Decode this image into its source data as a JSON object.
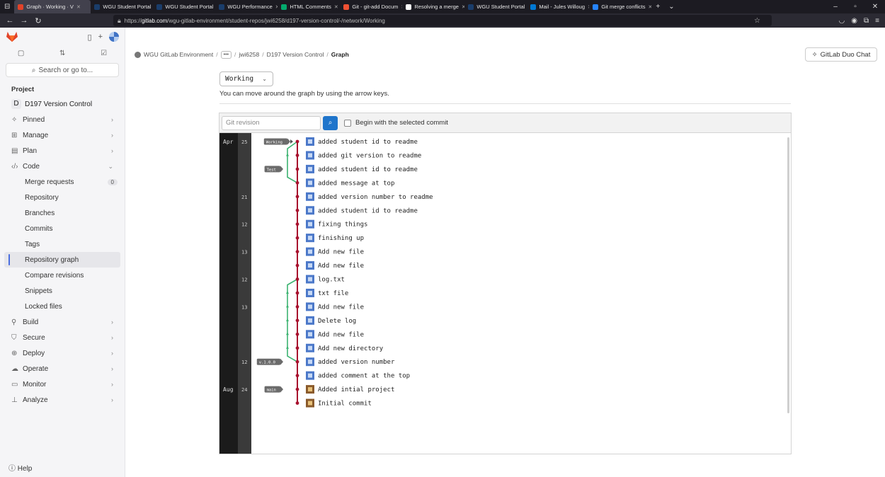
{
  "browser": {
    "tabs": [
      {
        "title": "Graph · Working · V",
        "active": true,
        "color": "#e24329"
      },
      {
        "title": "WGU Student Portal",
        "active": false,
        "color": "#1a3d6b"
      },
      {
        "title": "WGU Student Portal",
        "active": false,
        "color": "#1a3d6b"
      },
      {
        "title": "WGU Performance",
        "active": false,
        "color": "#1a3d6b"
      },
      {
        "title": "HTML Comments",
        "active": false,
        "color": "#04aa6d"
      },
      {
        "title": "Git - git-add Docum",
        "active": false,
        "color": "#f05133"
      },
      {
        "title": "Resolving a merge",
        "active": false,
        "color": "#ffffff"
      },
      {
        "title": "WGU Student Portal",
        "active": false,
        "color": "#1a3d6b"
      },
      {
        "title": "Mail - Jules Willoug",
        "active": false,
        "color": "#0078d4"
      },
      {
        "title": "Git merge conflicts",
        "active": false,
        "color": "#2684ff"
      }
    ],
    "url_prefix": "https://",
    "url_host": "gitlab.com",
    "url_path": "/wgu-gitlab-environment/student-repos/jwi6258/d197-version-control/-/network/Working"
  },
  "sidebar": {
    "search_label": "Search or go to...",
    "section_label": "Project",
    "project_letter": "D",
    "project_name": "D197 Version Control",
    "items_top": [
      {
        "icon": "pin-icon",
        "glyph": "✧",
        "label": "Pinned",
        "chevron": "›"
      },
      {
        "icon": "manage-icon",
        "glyph": "⊞",
        "label": "Manage",
        "chevron": "›"
      },
      {
        "icon": "plan-icon",
        "glyph": "▤",
        "label": "Plan",
        "chevron": "›"
      },
      {
        "icon": "code-icon",
        "glyph": "‹/›",
        "label": "Code",
        "chevron": "⌄"
      }
    ],
    "code_subitems": [
      {
        "label": "Merge requests",
        "badge": "0"
      },
      {
        "label": "Repository"
      },
      {
        "label": "Branches"
      },
      {
        "label": "Commits"
      },
      {
        "label": "Tags"
      },
      {
        "label": "Repository graph",
        "active": true
      },
      {
        "label": "Compare revisions"
      },
      {
        "label": "Snippets"
      },
      {
        "label": "Locked files"
      }
    ],
    "items_bottom": [
      {
        "icon": "rocket-icon",
        "glyph": "⚲",
        "label": "Build",
        "chevron": "›"
      },
      {
        "icon": "shield-icon",
        "glyph": "⛉",
        "label": "Secure",
        "chevron": "›"
      },
      {
        "icon": "deploy-icon",
        "glyph": "⊕",
        "label": "Deploy",
        "chevron": "›"
      },
      {
        "icon": "cloud-icon",
        "glyph": "☁",
        "label": "Operate",
        "chevron": "›"
      },
      {
        "icon": "monitor-icon",
        "glyph": "▭",
        "label": "Monitor",
        "chevron": "›"
      },
      {
        "icon": "chart-icon",
        "glyph": "⊥",
        "label": "Analyze",
        "chevron": "›"
      }
    ],
    "help_label": "Help"
  },
  "breadcrumbs": {
    "org": "WGU GitLab Environment",
    "ellipsis": "•••",
    "user": "jwi6258",
    "project": "D197 Version Control",
    "current": "Graph"
  },
  "duo_button": "GitLab Duo Chat",
  "branch_select": {
    "value": "Working"
  },
  "hint": "You can move around the graph by using the arrow keys.",
  "toolbar": {
    "revision_placeholder": "Git revision",
    "begin_label": "Begin with the selected commit"
  },
  "graph": {
    "colors": {
      "main": "#a8112e",
      "branch": "#3cb371",
      "month_bg": "#1b1b1b",
      "day_bg": "#3a3a3a",
      "label_bg": "#6b6b6b"
    },
    "months": [
      {
        "label": "Apr",
        "row": 0
      },
      {
        "label": "Aug",
        "row": 18
      }
    ],
    "days": [
      {
        "label": "25",
        "row": 0
      },
      {
        "label": "21",
        "row": 4
      },
      {
        "label": "12",
        "row": 6
      },
      {
        "label": "13",
        "row": 8
      },
      {
        "label": "12",
        "row": 10
      },
      {
        "label": "13",
        "row": 12
      },
      {
        "label": "12",
        "row": 16
      },
      {
        "label": "24",
        "row": 18
      }
    ],
    "refs": [
      {
        "label": "Working",
        "row": 0
      },
      {
        "label": "Test",
        "row": 2
      },
      {
        "label": "v.1.0.0",
        "row": 16
      },
      {
        "label": "main",
        "row": 18
      }
    ],
    "commits": [
      "added student id to readme",
      "added git version to readme",
      "added student id to readme",
      "added message at top",
      "added version number to readme",
      "added student id to readme",
      "fixing things",
      "finishing up",
      "Add new file",
      "Add new file",
      "log.txt",
      "txt file",
      "Add new file",
      "Delete log",
      "Add new file",
      "Add new directory",
      "added version number",
      "added comment at the top",
      "Added intial project",
      "Initial commit"
    ]
  }
}
